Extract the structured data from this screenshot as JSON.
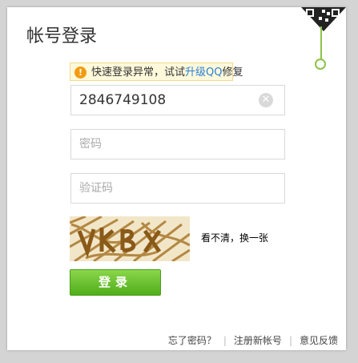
{
  "dialog": {
    "title": "帐号登录"
  },
  "notice": {
    "icon": "warning-icon",
    "text": "快速登录异常，试试",
    "link": "升级QQ",
    "suffix": "修复"
  },
  "form": {
    "account_value": "2846749108",
    "password_placeholder": "密码",
    "captcha_placeholder": "验证码",
    "clear_icon": "clear-icon",
    "captcha_refresh": "看不清，换一张",
    "login_label": "登录"
  },
  "footer": {
    "forgot": "忘了密码？",
    "register": "注册新帐号",
    "feedback": "意见反馈",
    "separator": "|"
  },
  "colors": {
    "accent_green": "#5cb82a",
    "link_blue": "#2a7fd4",
    "warning_orange": "#f29b11"
  }
}
